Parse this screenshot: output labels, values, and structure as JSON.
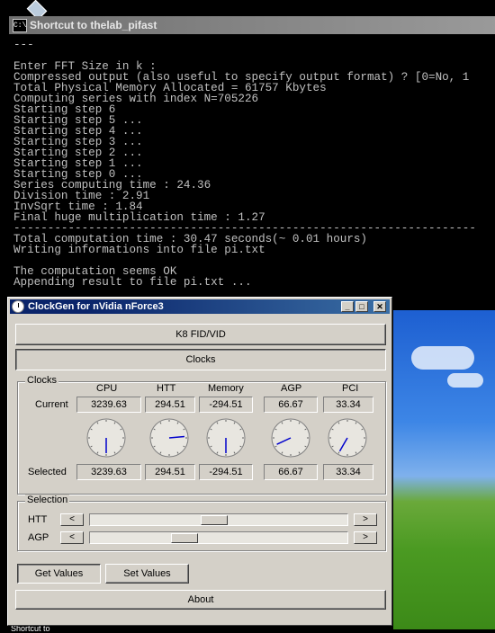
{
  "console": {
    "title": "Shortcut to thelab_pifast",
    "icon_label": "C:\\",
    "lines": [
      "---",
      "",
      "Enter FFT Size in k :",
      "Compressed output (also useful to specify output format) ? [0=No, 1",
      "Total Physical Memory Allocated = 61757 Kbytes",
      "Computing series with index N=705226",
      "Starting step 6",
      "Starting step 5 ...",
      "Starting step 4 ...",
      "Starting step 3 ...",
      "Starting step 2 ...",
      "Starting step 1 ...",
      "Starting step 0 ...",
      "Series computing time : 24.36",
      "Division time : 2.91",
      "InvSqrt time : 1.84",
      "Final huge multiplication time : 1.27",
      "--------------------------------------------------------------------",
      "Total computation time : 30.47 seconds(~ 0.01 hours)",
      "Writing informations into file pi.txt",
      "",
      "The computation seems OK",
      "Appending result to file pi.txt ..."
    ]
  },
  "clockgen": {
    "title": "ClockGen for nVidia nForce3",
    "window_controls": {
      "minimize": "_",
      "maximize": "□",
      "close": "✕"
    },
    "k8_button": "K8 FID/VID",
    "clocks_button": "Clocks",
    "clocks_group": "Clocks",
    "columns": [
      "CPU",
      "HTT",
      "Memory",
      "AGP",
      "PCI"
    ],
    "row_current": "Current",
    "row_selected": "Selected",
    "current": [
      "3239.63",
      "294.51",
      "-294.51",
      "66.67",
      "33.34"
    ],
    "selected": [
      "3239.63",
      "294.51",
      "-294.51",
      "66.67",
      "33.34"
    ],
    "gauge_angles_deg": [
      180,
      85,
      180,
      245,
      210
    ],
    "selection_group": "Selection",
    "htt_label": "HTT",
    "agp_label": "AGP",
    "htt_slider_fraction": 0.48,
    "agp_slider_fraction": 0.35,
    "arrow_left": "<",
    "arrow_right": ">",
    "get_values": "Get Values",
    "set_values": "Set Values",
    "about": "About"
  },
  "desktop": {
    "shortcut_label": "Shortcut to"
  },
  "colors": {
    "console_text": "#c0c0c0",
    "title_active": "#0a246a",
    "dialog_face": "#d4d0c8",
    "gauge_needle": "#0000cc"
  }
}
